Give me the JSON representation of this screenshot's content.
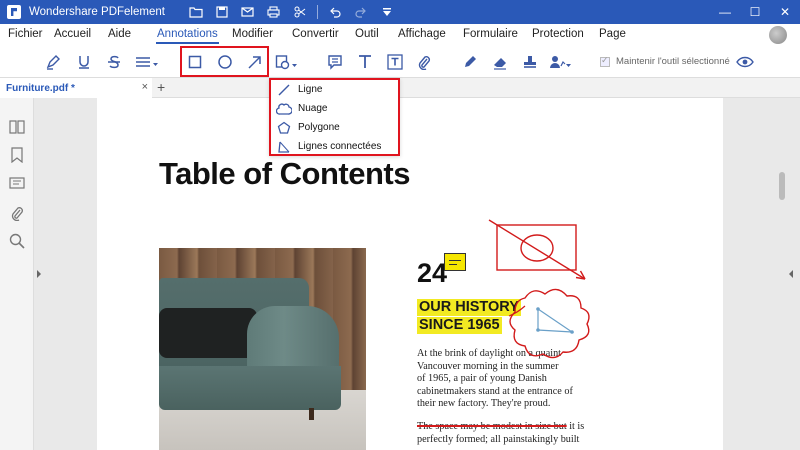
{
  "app": {
    "title": "Wondershare PDFelement"
  },
  "menu": {
    "items": [
      "Fichier",
      "Accueil",
      "Aide",
      "Annotations",
      "Modifier",
      "Convertir",
      "Outil",
      "Affichage",
      "Formulaire",
      "Protection",
      "Page"
    ],
    "active": "Annotations"
  },
  "toolbar": {
    "keep_tool_label": "Maintenir l'outil sélectionné",
    "highlight_box_color": "#e0141e"
  },
  "tabs": {
    "file_name": "Furniture.pdf *",
    "close": "×",
    "add": "+"
  },
  "dropdown": {
    "items": [
      {
        "label": "Ligne",
        "icon": "line-icon"
      },
      {
        "label": "Nuage",
        "icon": "cloud-icon"
      },
      {
        "label": "Polygone",
        "icon": "polygon-icon"
      },
      {
        "label": "Lignes connectées",
        "icon": "polyline-icon"
      }
    ]
  },
  "document": {
    "title": "Table of Contents",
    "page_number": "24",
    "heading_line1": "OUR HISTORY",
    "heading_line2": "SINCE 1965",
    "paragraph1": [
      "At the brink of daylight on a quaint",
      "Vancouver morning in the summer",
      "of 1965, a pair of young Danish",
      "cabinetmakers stand at the entrance of",
      "their new factory. They're proud."
    ],
    "paragraph2_struck": "The space may be modest in size but",
    "paragraph2_rest": " it is",
    "paragraph2_lines": [
      "perfectly formed; all painstakingly built"
    ]
  },
  "colors": {
    "brand_blue": "#2a59b8",
    "annotation_red": "#d21b1b",
    "highlight_yellow": "#f2ea22"
  }
}
